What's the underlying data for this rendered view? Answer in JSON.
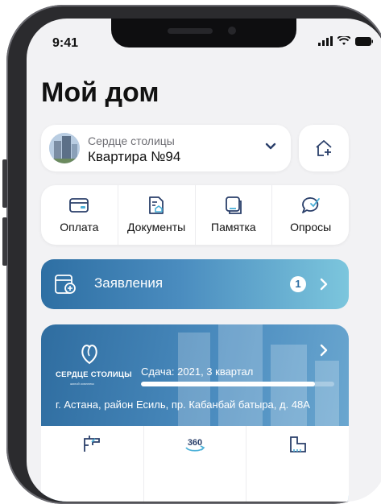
{
  "status_bar": {
    "time": "9:41"
  },
  "page": {
    "title": "Мой дом"
  },
  "apartment": {
    "complex_name": "Сердце столицы",
    "apartment_label": "Квартира №94"
  },
  "quick_actions": [
    {
      "label": "Оплата",
      "icon": "card-icon"
    },
    {
      "label": "Документы",
      "icon": "document-home-icon"
    },
    {
      "label": "Памятка",
      "icon": "memo-icon"
    },
    {
      "label": "Опросы",
      "icon": "survey-chat-icon"
    }
  ],
  "claims": {
    "label": "Заявления",
    "badge_count": "1"
  },
  "complex_card": {
    "logo_text": "СЕРДЦЕ СТОЛИЦЫ",
    "logo_subtext": "жилой комплекс",
    "delivery": "Сдача: 2021, 3 квартал",
    "progress": 0.9,
    "address": "г. Астана, район Есиль, пр. Кабанбай батыра, д. 48А",
    "actions": [
      {
        "icon": "floor-plan-icon"
      },
      {
        "icon": "tour-360-icon",
        "label": "360"
      },
      {
        "icon": "plan-measure-icon"
      }
    ]
  },
  "colors": {
    "accent": "#2e6fa3",
    "accent_light": "#7cc6dd",
    "background": "#f2f2f4"
  }
}
